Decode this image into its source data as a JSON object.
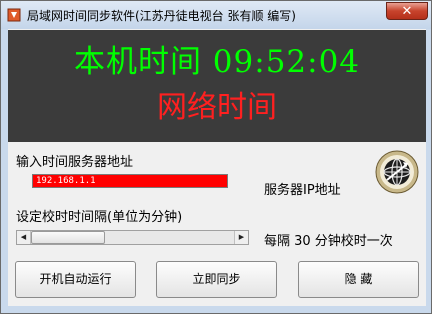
{
  "window": {
    "title": "局域网时间同步软件(江苏丹徒电视台 张有顺 编写)",
    "close_label": "✕"
  },
  "display": {
    "local_time": "本机时间 09:52:04",
    "network_time": "网络时间"
  },
  "server": {
    "label": "输入时间服务器地址",
    "value": "192.168.1.1",
    "ip_label": "服务器IP地址"
  },
  "interval": {
    "label": "设定校时时间隔(单位为分钟)",
    "text": "每隔 30 分钟校时一次",
    "minutes": 30,
    "scroll_left": "◀",
    "scroll_right": "▶"
  },
  "buttons": {
    "autostart": "开机自动运行",
    "sync_now": "立即同步",
    "hide": "隐  藏"
  },
  "colors": {
    "local_time": "#00ff00",
    "network_time": "#ff2020",
    "display_bg": "#3b3b3b",
    "input_bg": "#ff0000"
  },
  "icons": {
    "app": "app-icon",
    "globe": "globe-icon"
  }
}
